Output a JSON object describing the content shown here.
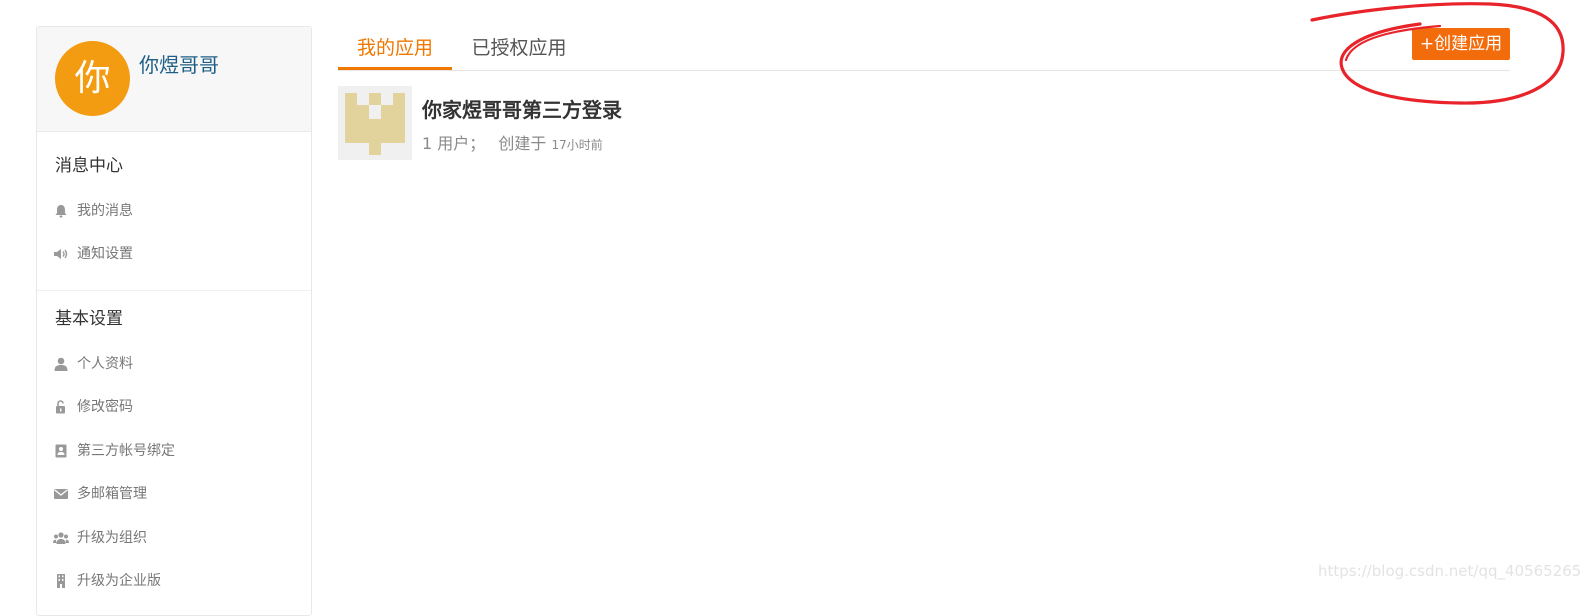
{
  "sidebar": {
    "avatar_char": "你",
    "username": "你煜哥哥",
    "sections": [
      {
        "title": "消息中心",
        "items": [
          {
            "label": "我的消息",
            "icon": "bell-icon"
          },
          {
            "label": "通知设置",
            "icon": "speaker-icon"
          }
        ]
      },
      {
        "title": "基本设置",
        "items": [
          {
            "label": "个人资料",
            "icon": "user-icon"
          },
          {
            "label": "修改密码",
            "icon": "unlock-icon"
          },
          {
            "label": "第三方帐号绑定",
            "icon": "contact-card-icon"
          },
          {
            "label": "多邮箱管理",
            "icon": "envelope-icon"
          },
          {
            "label": "升级为组织",
            "icon": "group-icon"
          },
          {
            "label": "升级为企业版",
            "icon": "building-icon"
          }
        ]
      }
    ]
  },
  "tabs": [
    {
      "label": "我的应用",
      "active": true
    },
    {
      "label": "已授权应用",
      "active": false
    }
  ],
  "create_button": "+创建应用",
  "app": {
    "name": "你家煜哥哥第三方登录",
    "users": "1 用户；",
    "created_prefix": "创建于",
    "created_time": "17小时前"
  },
  "watermark": "https://blog.csdn.net/qq_40565265",
  "colors": {
    "accent": "#f07800",
    "button": "#f36c0c",
    "avatar": "#f39c12",
    "username": "#1f5f86",
    "annotation": "#e8232a"
  }
}
